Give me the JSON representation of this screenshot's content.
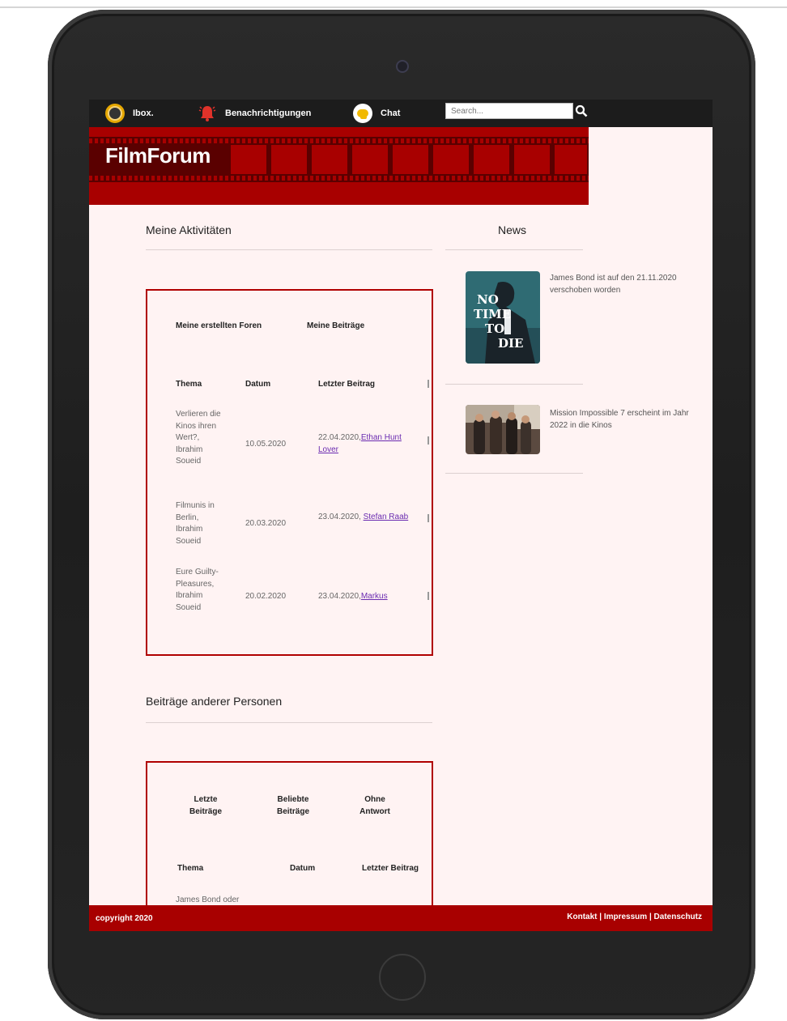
{
  "nav": {
    "items": [
      {
        "label": "Ibox.",
        "icon": "user-avatar-icon"
      },
      {
        "label": "Benachrichtigungen",
        "icon": "bell-icon"
      },
      {
        "label": "Chat",
        "icon": "chat-bubble-icon"
      }
    ],
    "search_placeholder": "Search...",
    "search_icon": "search-icon"
  },
  "banner": {
    "title": "FilmForum"
  },
  "activities": {
    "heading": "Meine Aktivitäten",
    "tabs": [
      "Meine erstellten Foren",
      "Meine Beiträge"
    ],
    "columns": [
      "Thema",
      "Datum",
      "Letzter Beitrag"
    ],
    "rows": [
      {
        "topic": "Verlieren die Kinos ihren Wert?, Ibrahim Soueid",
        "date": "10.05.2020",
        "last_prefix": "22.04.2020,",
        "last_user": "Ethan Hunt Lover"
      },
      {
        "topic": "Filmunis in Berlin, Ibrahim Soueid",
        "date": "20.03.2020",
        "last_prefix": "23.04.2020,",
        "last_user": "Stefan Raab"
      },
      {
        "topic": "Eure Guilty-Pleasures, Ibrahim Soueid",
        "date": "20.02.2020",
        "last_prefix": "23.04.2020,",
        "last_user": "Markus"
      }
    ]
  },
  "others": {
    "heading": "Beiträge anderer Personen",
    "tabs": [
      "Letzte Beiträge",
      "Beliebte Beiträge",
      "Ohne Antwort"
    ],
    "columns": [
      "Thema",
      "Datum",
      "Letzter Beitrag"
    ],
    "first_row_topic": "James Bond oder"
  },
  "news": {
    "heading": "News",
    "items": [
      {
        "text": "James Bond ist auf den 21.11.2020 verschoben worden",
        "image_text": "NO TIME TO DIE"
      },
      {
        "text": "Mission Impossible 7 erscheint im Jahr 2022 in die Kinos"
      }
    ]
  },
  "footer": {
    "copyright": "copyright 2020",
    "links": "Kontakt | Impressum | Datenschutz"
  }
}
